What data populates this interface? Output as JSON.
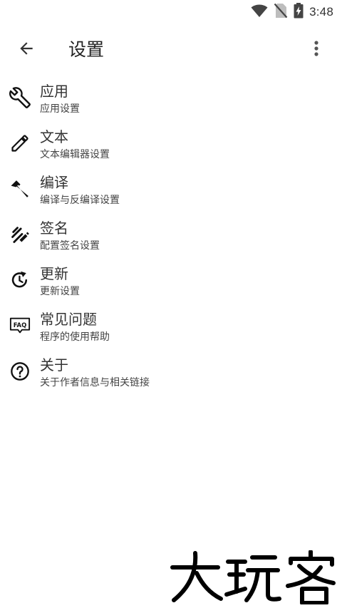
{
  "status_bar": {
    "time": "3:48",
    "icons": [
      "wifi-icon",
      "no-sim-icon",
      "battery-charging-icon"
    ]
  },
  "toolbar": {
    "title": "设置",
    "back_icon": "arrow-back-icon",
    "overflow_icon": "more-vert-icon"
  },
  "settings": [
    {
      "icon": "wrench-icon",
      "title": "应用",
      "subtitle": "应用设置"
    },
    {
      "icon": "pencil-icon",
      "title": "文本",
      "subtitle": "文本编辑器设置"
    },
    {
      "icon": "hammer-icon",
      "title": "编译",
      "subtitle": "编译与反编译设置"
    },
    {
      "icon": "signature-icon",
      "title": "签名",
      "subtitle": "配置签名设置"
    },
    {
      "icon": "update-icon",
      "title": "更新",
      "subtitle": "更新设置"
    },
    {
      "icon": "faq-icon",
      "title": "常见问题",
      "subtitle": "程序的使用帮助"
    },
    {
      "icon": "help-circle-icon",
      "title": "关于",
      "subtitle": "关于作者信息与相关链接"
    }
  ],
  "watermark": {
    "text": "大玩客"
  }
}
